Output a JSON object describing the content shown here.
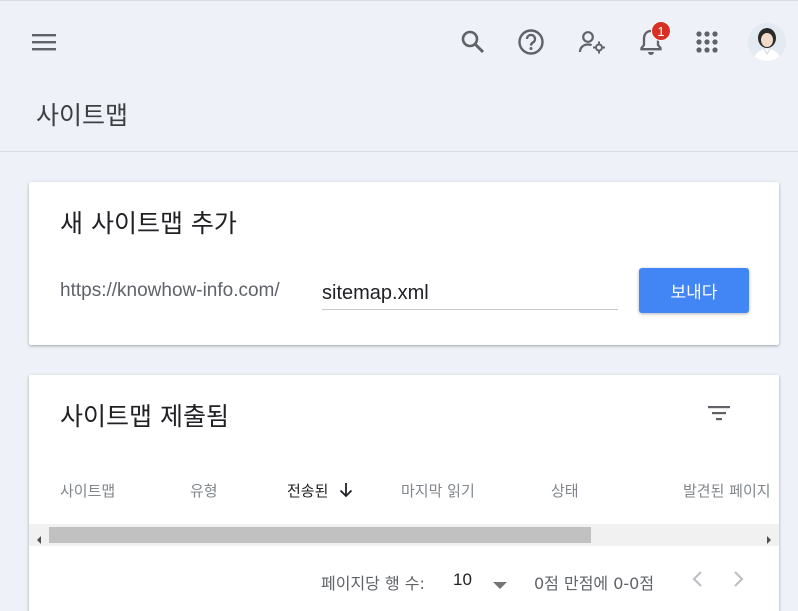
{
  "header": {
    "notification_count": "1",
    "page_title": "사이트맵"
  },
  "add_card": {
    "title": "새 사이트맵 추가",
    "url_prefix": "https://knowhow-info.com/",
    "input_value": "sitemap.xml",
    "submit_label": "보내다"
  },
  "list_card": {
    "title": "사이트맵 제출됨",
    "columns": [
      {
        "label": "사이트맵"
      },
      {
        "label": "유형"
      },
      {
        "label": "전송된",
        "sort": "desc"
      },
      {
        "label": "마지막 읽기"
      },
      {
        "label": "상태"
      },
      {
        "label": "발견된 페이지"
      }
    ]
  },
  "pagination": {
    "rows_label": "페이지당 행 수:",
    "rows_value": "10",
    "range_text": "0점 만점에 0-0점"
  },
  "colors": {
    "accent": "#4285f4",
    "badge": "#d93025",
    "background": "#eef2f8"
  },
  "icons": [
    "menu-icon",
    "search-icon",
    "help-icon",
    "manage-accounts-icon",
    "notifications-icon",
    "apps-icon",
    "filter-icon",
    "arrow-down-icon",
    "chevron-left-icon",
    "chevron-right-icon"
  ]
}
